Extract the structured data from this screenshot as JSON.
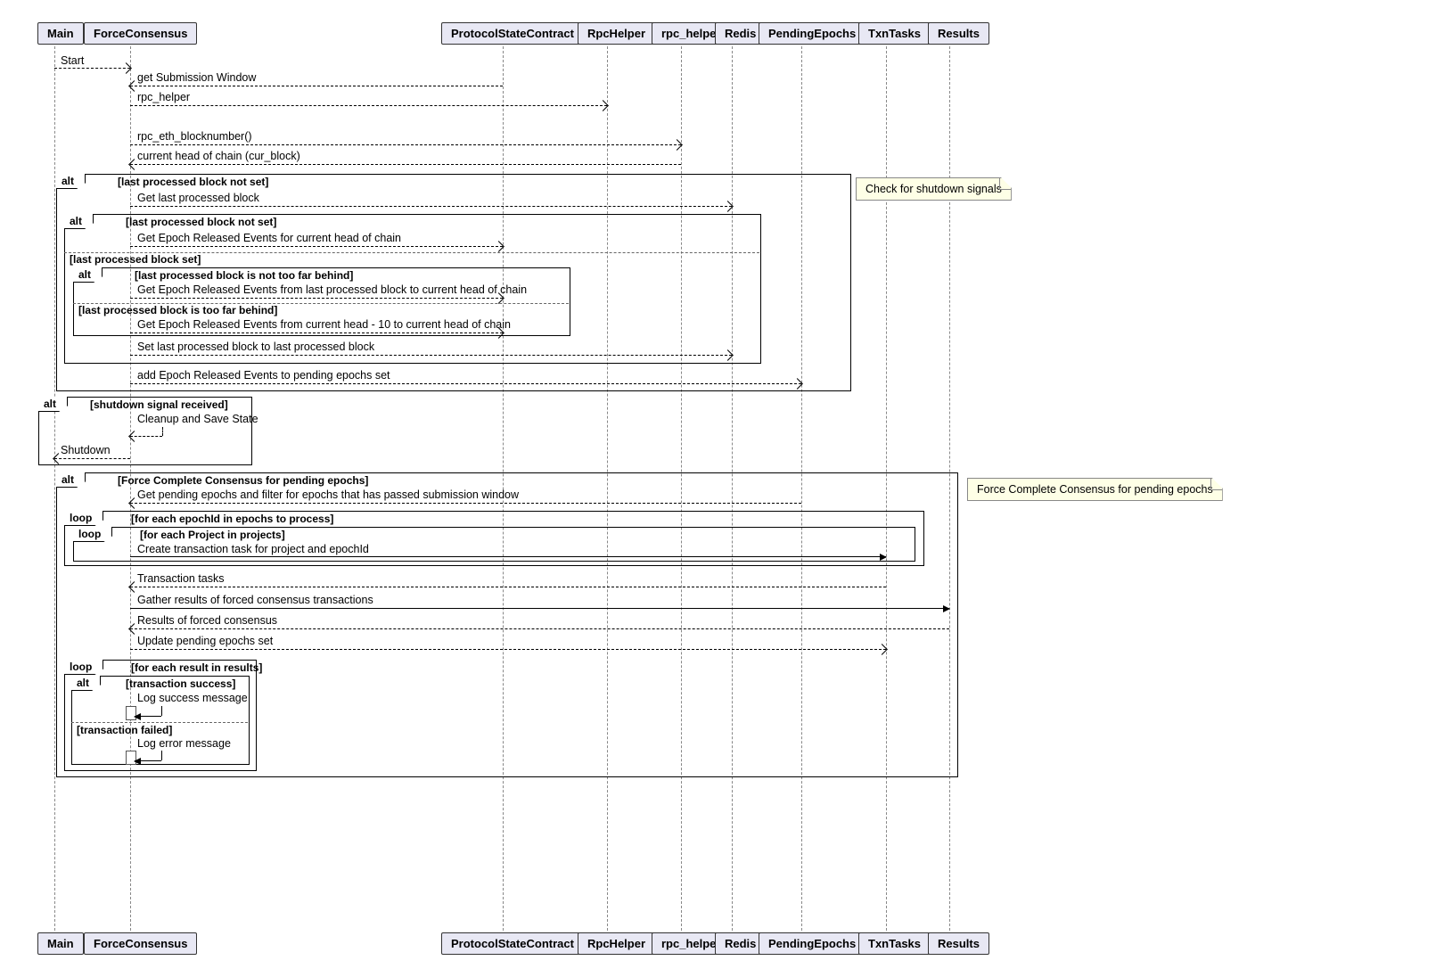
{
  "participants": {
    "p0": "Main",
    "p1": "ForceConsensus",
    "p2": "ProtocolStateContract",
    "p3": "RpcHelper",
    "p4": "rpc_helper",
    "p5": "Redis",
    "p6": "PendingEpochs",
    "p7": "TxnTasks",
    "p8": "Results"
  },
  "messages": {
    "m0": "Start",
    "m1": "get Submission Window",
    "m2": "rpc_helper",
    "m3": "rpc_eth_blocknumber()",
    "m4": "current head of chain (cur_block)",
    "m5": "Get last processed block",
    "m6": "Get Epoch Released Events for current head of chain",
    "m7": "Get Epoch Released Events from last processed block to current head of chain",
    "m8": "Get Epoch Released Events from current head - 10 to current head of chain",
    "m9": "Set last processed block to last processed block",
    "m10": "add Epoch Released Events to pending epochs set",
    "m11": "Cleanup and Save State",
    "m12": "Shutdown",
    "m13": "Get pending epochs and filter for epochs that has passed submission window",
    "m14": "Create transaction task for project and epochId",
    "m15": "Transaction tasks",
    "m16": "Gather results of forced consensus transactions",
    "m17": "Results of forced consensus",
    "m18": "Update pending epochs set",
    "m19": "Log success message",
    "m20": "Log error message"
  },
  "fragments": {
    "alt": "alt",
    "loop": "loop",
    "g0": "[last processed block not set]",
    "g1": "[last processed block not set]",
    "g2": "[last processed block set]",
    "g3": "[last processed block is not too far behind]",
    "g4": "[last processed block is too far behind]",
    "g5": "[shutdown signal received]",
    "g6": "[Force Complete Consensus for pending epochs]",
    "g7": "[for each epochId in epochs to process]",
    "g8": "[for each Project in projects]",
    "g9": "[for each result in results]",
    "g10": "[transaction success]",
    "g11": "[transaction failed]"
  },
  "notes": {
    "n0": "Check for shutdown signals",
    "n1": "Force Complete Consensus for pending epochs"
  },
  "chart_data": {
    "type": "uml_sequence_diagram",
    "participants": [
      "Main",
      "ForceConsensus",
      "ProtocolStateContract",
      "RpcHelper",
      "rpc_helper",
      "Redis",
      "PendingEpochs",
      "TxnTasks",
      "Results"
    ],
    "interactions": [
      {
        "from": "Main",
        "to": "ForceConsensus",
        "label": "Start",
        "style": "async"
      },
      {
        "from": "ForceConsensus",
        "to": "ProtocolStateContract",
        "label": "get Submission Window",
        "style": "return"
      },
      {
        "from": "ForceConsensus",
        "to": "RpcHelper",
        "label": "rpc_helper",
        "style": "async"
      },
      {
        "from": "ForceConsensus",
        "to": "rpc_helper",
        "label": "rpc_eth_blocknumber()",
        "style": "async"
      },
      {
        "from": "rpc_helper",
        "to": "ForceConsensus",
        "label": "current head of chain (cur_block)",
        "style": "return"
      },
      {
        "fragment": "alt",
        "guard": "last processed block not set",
        "note": "Check for shutdown signals",
        "children": [
          {
            "from": "ForceConsensus",
            "to": "Redis",
            "label": "Get last processed block",
            "style": "async"
          },
          {
            "fragment": "alt",
            "guard": "last processed block not set",
            "children": [
              {
                "from": "ForceConsensus",
                "to": "ProtocolStateContract",
                "label": "Get Epoch Released Events for current head of chain",
                "style": "async"
              }
            ],
            "else": [
              {
                "guard": "last processed block set",
                "children": [
                  {
                    "fragment": "alt",
                    "guard": "last processed block is not too far behind",
                    "children": [
                      {
                        "from": "ForceConsensus",
                        "to": "ProtocolStateContract",
                        "label": "Get Epoch Released Events from last processed block to current head of chain",
                        "style": "async"
                      }
                    ],
                    "else": [
                      {
                        "guard": "last processed block is too far behind",
                        "children": [
                          {
                            "from": "ForceConsensus",
                            "to": "ProtocolStateContract",
                            "label": "Get Epoch Released Events from current head - 10 to current head of chain",
                            "style": "async"
                          }
                        ]
                      }
                    ]
                  }
                ]
              }
            ]
          },
          {
            "from": "ForceConsensus",
            "to": "Redis",
            "label": "Set last processed block to last processed block",
            "style": "async"
          },
          {
            "from": "ForceConsensus",
            "to": "PendingEpochs",
            "label": "add Epoch Released Events to pending epochs set",
            "style": "async"
          }
        ]
      },
      {
        "fragment": "alt",
        "guard": "shutdown signal received",
        "children": [
          {
            "from": "ForceConsensus",
            "to": "ForceConsensus",
            "label": "Cleanup and Save State",
            "style": "return"
          },
          {
            "from": "ForceConsensus",
            "to": "Main",
            "label": "Shutdown",
            "style": "return"
          }
        ]
      },
      {
        "fragment": "alt",
        "guard": "Force Complete Consensus for pending epochs",
        "children": [
          {
            "from": "PendingEpochs",
            "to": "ForceConsensus",
            "label": "Get pending epochs and filter for epochs that has passed submission window",
            "style": "return"
          },
          {
            "fragment": "loop",
            "guard": "for each epochId in epochs to process",
            "children": [
              {
                "fragment": "loop",
                "guard": "for each Project in projects",
                "children": [
                  {
                    "from": "ForceConsensus",
                    "to": "TxnTasks",
                    "label": "Create transaction task for project and epochId",
                    "style": "sync"
                  }
                ]
              }
            ]
          },
          {
            "from": "TxnTasks",
            "to": "ForceConsensus",
            "label": "Transaction tasks",
            "style": "return"
          },
          {
            "from": "ForceConsensus",
            "to": "Results",
            "label": "Gather results of forced consensus transactions",
            "style": "sync"
          },
          {
            "from": "Results",
            "to": "ForceConsensus",
            "label": "Results of forced consensus",
            "style": "return"
          },
          {
            "from": "ForceConsensus",
            "to": "TxnTasks",
            "label": "Update pending epochs set",
            "style": "async"
          },
          {
            "fragment": "loop",
            "guard": "for each result in results",
            "children": [
              {
                "fragment": "alt",
                "guard": "transaction success",
                "children": [
                  {
                    "from": "ForceConsensus",
                    "to": "ForceConsensus",
                    "label": "Log success message",
                    "style": "sync"
                  }
                ],
                "else": [
                  {
                    "guard": "transaction failed",
                    "children": [
                      {
                        "from": "ForceConsensus",
                        "to": "ForceConsensus",
                        "label": "Log error message",
                        "style": "sync"
                      }
                    ]
                  }
                ]
              }
            ]
          }
        ]
      }
    ]
  }
}
